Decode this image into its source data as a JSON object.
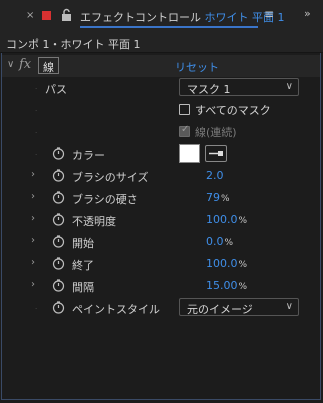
{
  "tab": {
    "close": "×",
    "title_prefix": "エフェクトコントロール",
    "title_layer": "ホワイト 平面 1",
    "menu": "≡",
    "more": "»",
    "label_color": "#d83131"
  },
  "comp": {
    "breadcrumb": "コンポ 1・ホワイト 平面 1"
  },
  "effect": {
    "fx": "fx",
    "name": "線",
    "reset": "リセット"
  },
  "props": {
    "path": {
      "label": "パス",
      "value": "マスク 1"
    },
    "all_masks": {
      "label": "すべてのマスク",
      "checked": false
    },
    "stroke_seq": {
      "label": "線(連続)",
      "checked": true
    },
    "color": {
      "label": "カラー",
      "value": "#ffffff"
    },
    "brush_size": {
      "label": "ブラシのサイズ",
      "value": "2.0",
      "unit": ""
    },
    "brush_hardness": {
      "label": "ブラシの硬さ",
      "value": "79",
      "unit": "%"
    },
    "opacity": {
      "label": "不透明度",
      "value": "100.0",
      "unit": "%"
    },
    "start": {
      "label": "開始",
      "value": "0.0",
      "unit": "%"
    },
    "end": {
      "label": "終了",
      "value": "100.0",
      "unit": "%"
    },
    "spacing": {
      "label": "間隔",
      "value": "15.00",
      "unit": "%"
    },
    "paint_style": {
      "label": "ペイントスタイル",
      "value": "元のイメージ"
    }
  },
  "colors": {
    "accent": "#3f8ee8",
    "panel_bg": "#1c1c1c",
    "label_red": "#d83131"
  }
}
